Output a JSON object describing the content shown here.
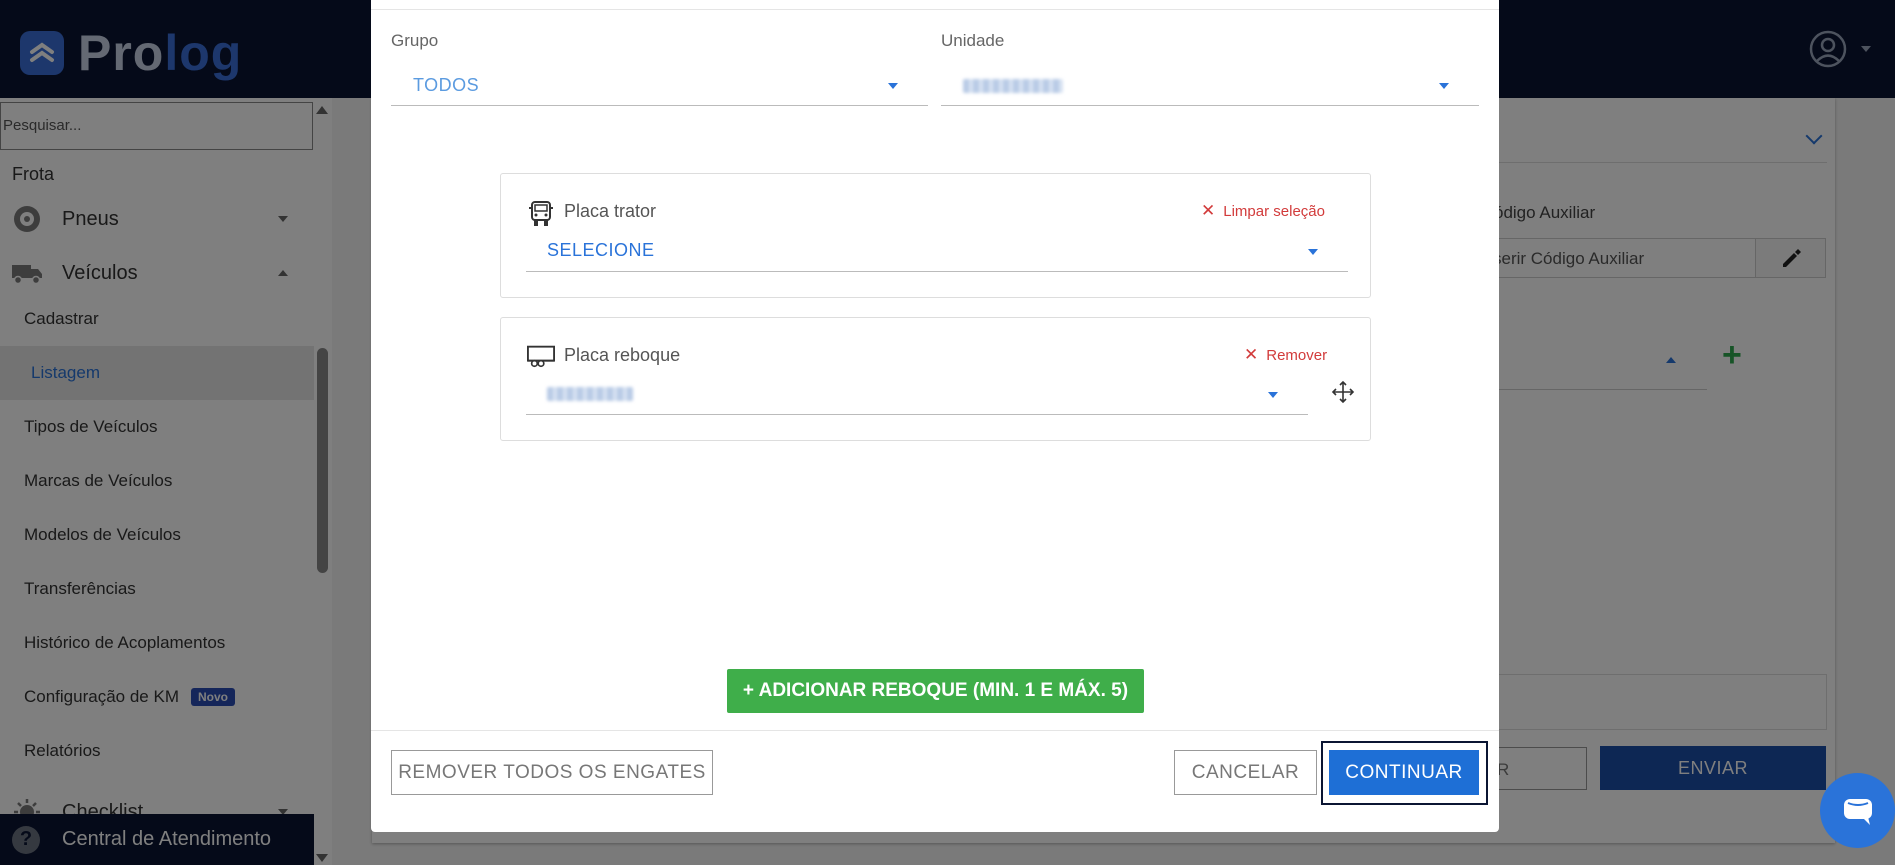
{
  "app": {
    "brand": {
      "part1": "Pro",
      "part2": "log"
    }
  },
  "sidebar": {
    "search_placeholder": "Pesquisar...",
    "section": "Frota",
    "groups": [
      {
        "label": "Pneus",
        "icon": "tire-icon",
        "expanded": false
      },
      {
        "label": "Veículos",
        "icon": "truck-icon",
        "expanded": true
      },
      {
        "label": "Checklist",
        "icon": "checklist-icon",
        "expanded": false
      }
    ],
    "items": [
      {
        "label": "Cadastrar",
        "active": false
      },
      {
        "label": "Listagem",
        "active": true
      },
      {
        "label": "Tipos de Veículos",
        "active": false
      },
      {
        "label": "Marcas de Veículos",
        "active": false
      },
      {
        "label": "Modelos de Veículos",
        "active": false
      },
      {
        "label": "Transferências",
        "active": false
      },
      {
        "label": "Histórico de Acoplamentos",
        "active": false
      },
      {
        "label": "Configuração de KM",
        "active": false,
        "badge": "Novo"
      },
      {
        "label": "Relatórios",
        "active": false
      }
    ],
    "central": "Central de Atendimento"
  },
  "background": {
    "aux_label": "ódigo Auxiliar",
    "aux_placeholder": "serir Código Auxiliar",
    "btn_partial": "R",
    "btn_enviar": "ENVIAR"
  },
  "modal": {
    "grupo_label": "Grupo",
    "grupo_value": "TODOS",
    "unidade_label": "Unidade",
    "trator": {
      "label": "Placa trator",
      "action": "Limpar seleção",
      "value": "SELECIONE"
    },
    "reboque": {
      "label": "Placa reboque",
      "action": "Remover"
    },
    "add_button": "+ ADICIONAR REBOQUE (MIN. 1 E MÁX. 5)",
    "remove_all": "REMOVER TODOS OS ENGATES",
    "cancel": "CANCELAR",
    "continue": "CONTINUAR"
  },
  "colors": {
    "navy": "#0b1533",
    "primary": "#1e6fd6",
    "success": "#3fae4a",
    "danger": "#d23b3b"
  }
}
